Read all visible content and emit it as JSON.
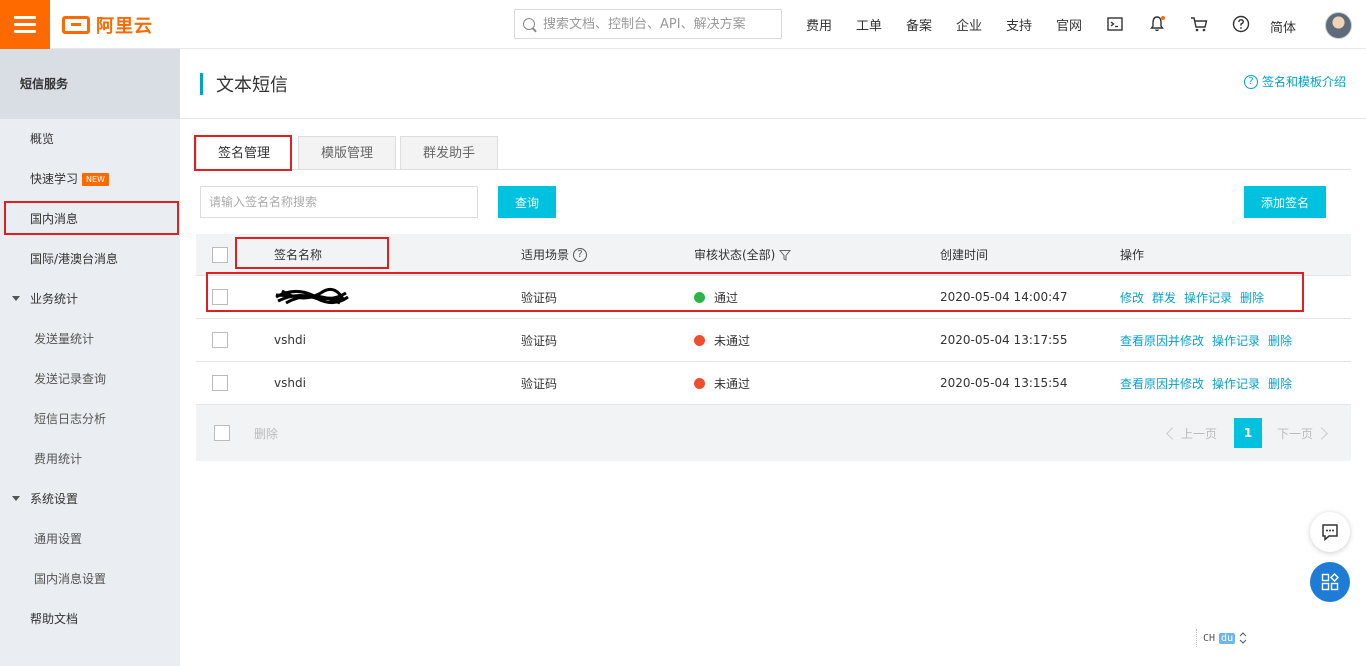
{
  "header": {
    "logo_text": "阿里云",
    "search_placeholder": "搜索文档、控制台、API、解决方案",
    "nav": [
      "费用",
      "工单",
      "备案",
      "企业",
      "支持",
      "官网"
    ],
    "language": "简体"
  },
  "sidebar": {
    "title": "短信服务",
    "items": {
      "overview": "概览",
      "quick_learn": "快速学习",
      "quick_learn_badge": "NEW",
      "domestic": "国内消息",
      "international": "国际/港澳台消息",
      "stats_group": "业务统计",
      "send_stats": "发送量统计",
      "send_records": "发送记录查询",
      "log_analysis": "短信日志分析",
      "cost_stats": "费用统计",
      "settings_group": "系统设置",
      "general_settings": "通用设置",
      "domestic_settings": "国内消息设置",
      "help_docs": "帮助文档"
    }
  },
  "page": {
    "title": "文本短信",
    "help_link": "签名和模板介绍"
  },
  "tabs": [
    "签名管理",
    "模版管理",
    "群发助手"
  ],
  "toolbar": {
    "search_placeholder": "请输入签名名称搜索",
    "query_label": "查询",
    "add_label": "添加签名"
  },
  "table": {
    "columns": [
      "签名名称",
      "适用场景",
      "审核状态(全部)",
      "创建时间",
      "操作"
    ],
    "rows": [
      {
        "name": "",
        "scene": "验证码",
        "status": "通过",
        "status_color": "#2cb34a",
        "created": "2020-05-04 14:00:47",
        "actions": [
          "修改",
          "群发",
          "操作记录",
          "删除"
        ]
      },
      {
        "name": "vshdi",
        "scene": "验证码",
        "status": "未通过",
        "status_color": "#f04e2e",
        "created": "2020-05-04 13:17:55",
        "actions": [
          "查看原因并修改",
          "操作记录",
          "删除"
        ]
      },
      {
        "name": "vshdi",
        "scene": "验证码",
        "status": "未通过",
        "status_color": "#f04e2e",
        "created": "2020-05-04 13:15:54",
        "actions": [
          "查看原因并修改",
          "操作记录",
          "删除"
        ]
      }
    ],
    "footer": {
      "delete_label": "删除",
      "prev_label": "上一页",
      "next_label": "下一页",
      "current_page": "1"
    }
  },
  "ime": {
    "left": "CH",
    "right": "du"
  },
  "colors": {
    "brand": "#ff6a00",
    "accent": "#00c1de",
    "link": "#0aa0c8",
    "annotation": "#e02020"
  }
}
